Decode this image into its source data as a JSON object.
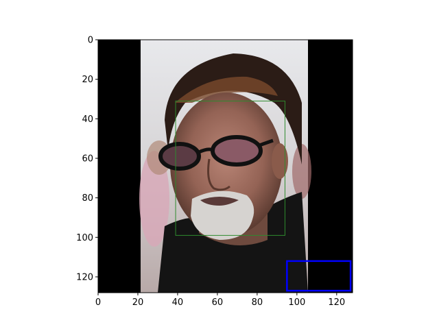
{
  "figure": {
    "image": {
      "description_icon": "portrait-photo-icon",
      "x_range": [
        0,
        128
      ],
      "y_range": [
        0,
        128
      ],
      "content_x_range": [
        21,
        106
      ]
    },
    "x_ticks": [
      0,
      20,
      40,
      60,
      80,
      100,
      120
    ],
    "y_ticks": [
      0,
      20,
      40,
      60,
      80,
      100,
      120
    ],
    "boxes": [
      {
        "name": "face-box",
        "color": "#2e8b2e",
        "x0": 39,
        "x1": 94,
        "y0": 31,
        "y1": 99,
        "stroke_width": 1
      },
      {
        "name": "blue-box",
        "color": "#0000ff",
        "x0": 95,
        "x1": 127,
        "y0": 112,
        "y1": 127,
        "stroke_width": 2.5
      }
    ]
  }
}
